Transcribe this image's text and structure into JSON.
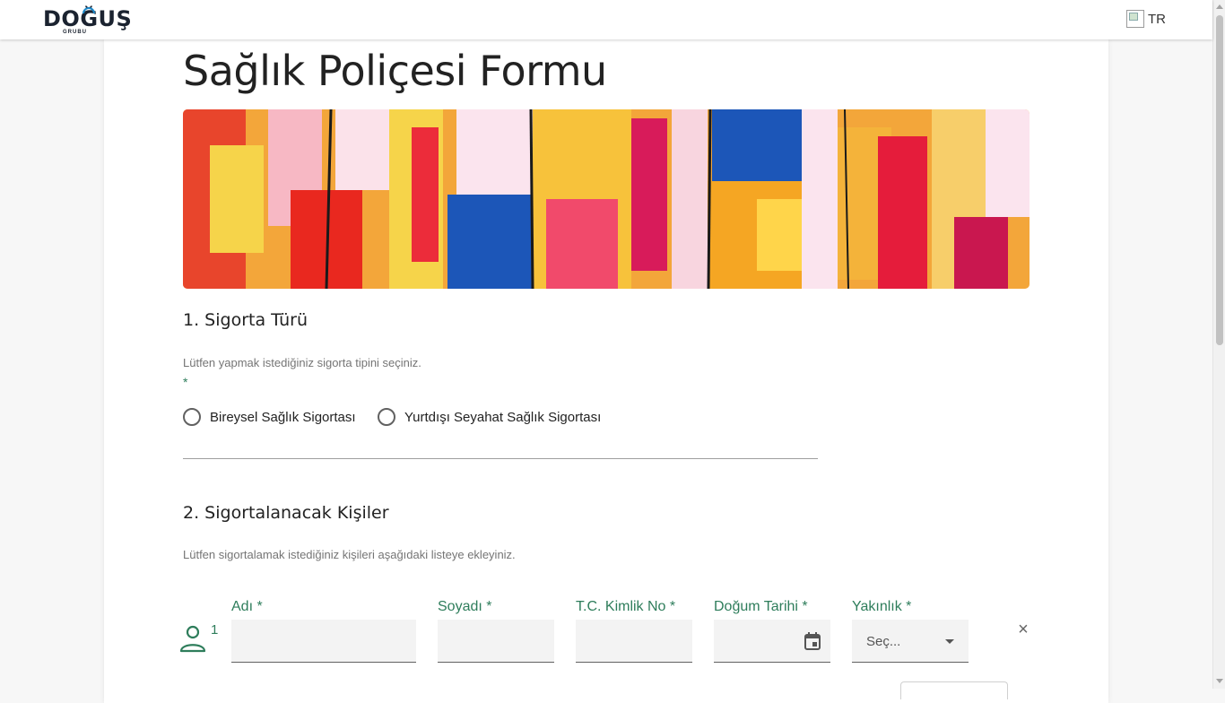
{
  "header": {
    "logo_text": "DOĞUŞ",
    "logo_subtext": "GRUBU",
    "language": "TR"
  },
  "page": {
    "title": "Sağlık Poliçesi Formu"
  },
  "section1": {
    "title": "1. Sigorta Türü",
    "help": "Lütfen yapmak istediğiniz sigorta tipini seçiniz.",
    "required_mark": "*",
    "options": [
      {
        "label": "Bireysel Sağlık Sigortası",
        "selected": false
      },
      {
        "label": "Yurtdışı Seyahat Sağlık Sigortası",
        "selected": false
      }
    ]
  },
  "section2": {
    "title": "2. Sigortalanacak Kişiler",
    "help": "Lütfen sigortalamak istediğiniz kişileri aşağıdaki listeye ekleyiniz.",
    "row_number": "1",
    "fields": {
      "first_name": {
        "label": "Adı *",
        "value": ""
      },
      "last_name": {
        "label": "Soyadı *",
        "value": ""
      },
      "tc_no": {
        "label": "T.C. Kimlik No *",
        "value": ""
      },
      "birth_date": {
        "label": "Doğum Tarihi *",
        "value": ""
      },
      "relation": {
        "label": "Yakınlık *",
        "selected": "Seç..."
      }
    },
    "remove_symbol": "×"
  },
  "icons": [
    "person-icon",
    "calendar-icon",
    "close-icon",
    "dropdown-icon",
    "flag-icon"
  ],
  "colors": {
    "accent_green": "#2e7d5b",
    "field_bg": "#f3f3f3",
    "text_dark": "#222222",
    "muted_text": "#757575"
  }
}
